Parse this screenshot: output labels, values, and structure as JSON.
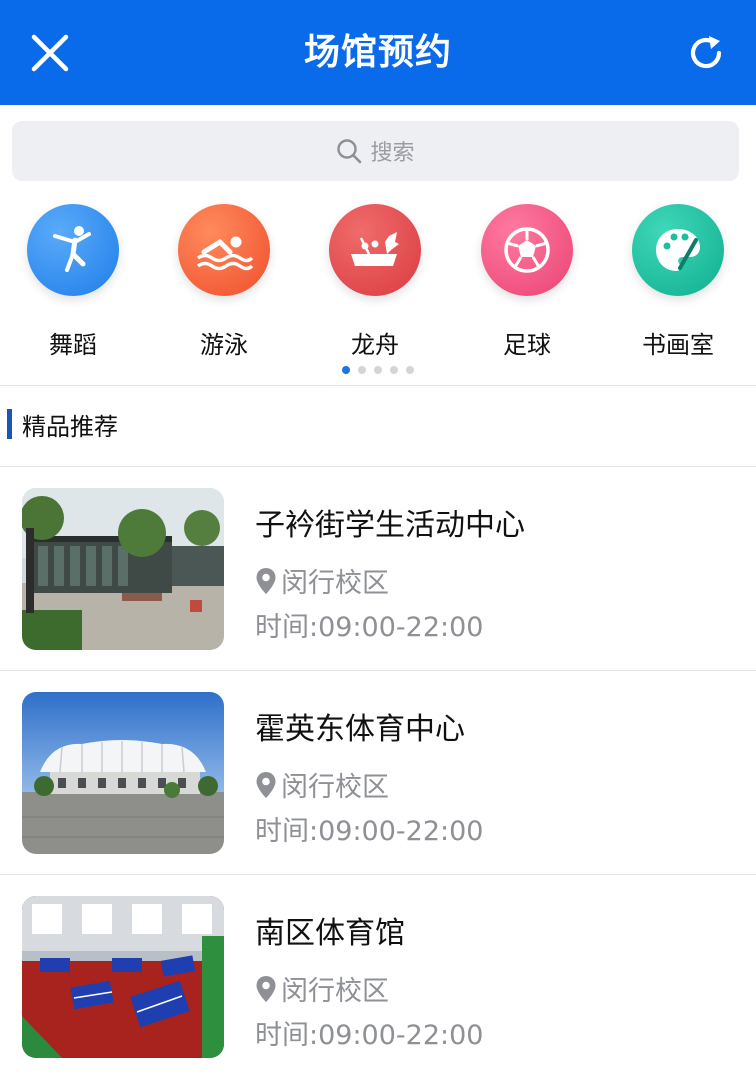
{
  "header": {
    "title": "场馆预约",
    "close_icon": "close-icon",
    "refresh_icon": "refresh-icon",
    "bg_color": "#0a6bea"
  },
  "search": {
    "placeholder": "搜索",
    "icon": "search-icon"
  },
  "categories": [
    {
      "label": "舞蹈",
      "icon": "dance-icon",
      "color": "#2d8ef0"
    },
    {
      "label": "游泳",
      "icon": "swim-icon",
      "color": "#f4623a"
    },
    {
      "label": "龙舟",
      "icon": "dragon-boat-icon",
      "color": "#e5484d"
    },
    {
      "label": "足球",
      "icon": "football-icon",
      "color": "#f04f7c"
    },
    {
      "label": "书画室",
      "icon": "palette-icon",
      "color": "#19bfa0"
    }
  ],
  "pager": {
    "pages": 5,
    "active": 1
  },
  "section": {
    "title": "精品推荐"
  },
  "venues": [
    {
      "name": "子衿街学生活动中心",
      "campus": "闵行校区",
      "hours": "时间:09:00-22:00",
      "image": "building-photo"
    },
    {
      "name": "霍英东体育中心",
      "campus": "闵行校区",
      "hours": "时间:09:00-22:00",
      "image": "stadium-photo"
    },
    {
      "name": "南区体育馆",
      "campus": "闵行校区",
      "hours": "时间:09:00-22:00",
      "image": "gym-photo"
    }
  ]
}
